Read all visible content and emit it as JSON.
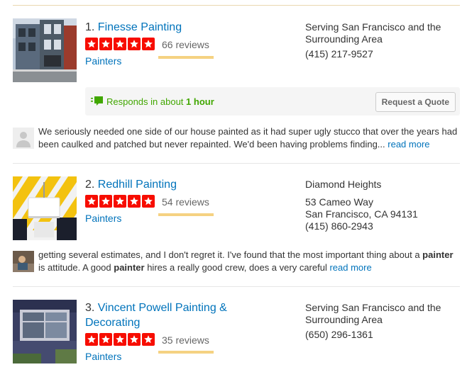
{
  "listings": [
    {
      "number": "1.",
      "name": "Finesse Painting",
      "rating": 5,
      "reviews": "66 reviews",
      "category": "Painters",
      "address": [
        "Serving San Francisco and the",
        "Surrounding Area",
        "(415) 217-9527"
      ],
      "responds_text": "Responds in about",
      "responds_time": "1 hour",
      "quote_button": "Request a Quote",
      "snippet": "We seriously needed one side of our house painted as it had super ugly stucco that over the years had been caulked and patched but never repainted. We'd been having problems finding...",
      "read_more": "read more"
    },
    {
      "number": "2.",
      "name": "Redhill Painting",
      "rating": 5,
      "reviews": "54 reviews",
      "category": "Painters",
      "address": [
        "Diamond Heights",
        "53 Cameo Way",
        "San Francisco, CA 94131",
        "(415) 860-2943"
      ],
      "snippet_parts": [
        "getting several estimates, and I don't regret it. I've found that the most important thing about a ",
        "painter",
        " is attitude. A good ",
        "painter",
        " hires a really good crew, does a very careful "
      ],
      "read_more": "read more"
    },
    {
      "number": "3.",
      "name": "Vincent Powell Painting & Decorating",
      "rating": 5,
      "reviews": "35 reviews",
      "category": "Painters",
      "address": [
        "Serving San Francisco and the",
        "Surrounding Area",
        "(650) 296-1361"
      ]
    }
  ],
  "colors": {
    "link": "#0073bb",
    "star": "#f70d00",
    "responds": "#41a700",
    "review_bar": "#f5d282"
  },
  "icons": {
    "star": "star-icon",
    "chat": "chat-bubble-icon",
    "avatar": "user-avatar-icon"
  }
}
